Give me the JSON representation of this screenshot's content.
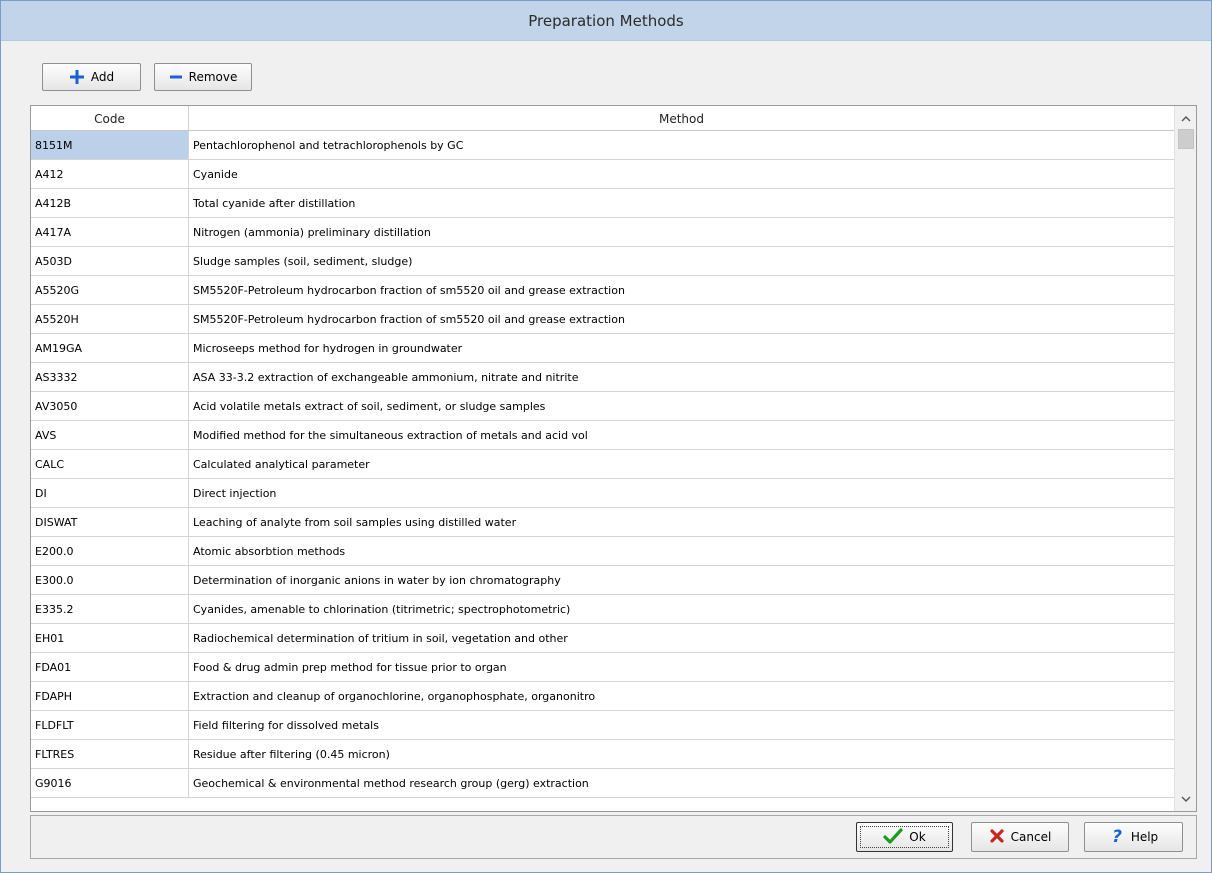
{
  "window": {
    "title": "Preparation Methods"
  },
  "toolbar": {
    "add_label": "Add",
    "remove_label": "Remove"
  },
  "table": {
    "columns": [
      "Code",
      "Method"
    ],
    "rows": [
      {
        "code": "8151M",
        "method": "Pentachlorophenol and tetrachlorophenols by GC"
      },
      {
        "code": "A412",
        "method": "Cyanide"
      },
      {
        "code": "A412B",
        "method": "Total cyanide after distillation"
      },
      {
        "code": "A417A",
        "method": "Nitrogen (ammonia) preliminary distillation"
      },
      {
        "code": "A503D",
        "method": "Sludge samples (soil, sediment, sludge)"
      },
      {
        "code": "A5520G",
        "method": "SM5520F-Petroleum hydrocarbon fraction of sm5520 oil and grease extraction"
      },
      {
        "code": "A5520H",
        "method": "SM5520F-Petroleum hydrocarbon fraction of sm5520 oil and grease extraction"
      },
      {
        "code": "AM19GA",
        "method": "Microseeps method for hydrogen in groundwater"
      },
      {
        "code": "AS3332",
        "method": "ASA 33-3.2 extraction of exchangeable ammonium, nitrate and nitrite"
      },
      {
        "code": "AV3050",
        "method": "Acid volatile metals extract of soil, sediment, or sludge samples"
      },
      {
        "code": "AVS",
        "method": "Modified method for the simultaneous extraction of metals and acid vol"
      },
      {
        "code": "CALC",
        "method": "Calculated analytical parameter"
      },
      {
        "code": "DI",
        "method": "Direct injection"
      },
      {
        "code": "DISWAT",
        "method": "Leaching of analyte from soil samples using distilled water"
      },
      {
        "code": "E200.0",
        "method": "Atomic absorbtion methods"
      },
      {
        "code": "E300.0",
        "method": "Determination of inorganic anions in water by ion chromatography"
      },
      {
        "code": "E335.2",
        "method": "Cyanides, amenable to chlorination (titrimetric; spectrophotometric)"
      },
      {
        "code": "EH01",
        "method": "Radiochemical determination of tritium in soil, vegetation and other"
      },
      {
        "code": "FDA01",
        "method": "Food & drug admin prep method for tissue prior to organ"
      },
      {
        "code": "FDAPH",
        "method": "Extraction and cleanup of organochlorine, organophosphate, organonitro"
      },
      {
        "code": "FLDFLT",
        "method": "Field filtering for dissolved metals"
      },
      {
        "code": "FLTRES",
        "method": "Residue after filtering (0.45 micron)"
      },
      {
        "code": "G9016",
        "method": "Geochemical & environmental method research group (gerg) extraction"
      }
    ],
    "selected_code": "8151M"
  },
  "footer": {
    "ok_label": "Ok",
    "cancel_label": "Cancel",
    "help_label": "Help"
  },
  "icons": {
    "add": "plus-icon",
    "remove": "minus-icon",
    "ok": "checkmark-icon",
    "cancel": "x-icon",
    "help": "question-mark-icon",
    "scroll_up": "chevron-up-icon",
    "scroll_down": "chevron-down-icon"
  },
  "colors": {
    "title_bar": "#c2d4ea",
    "selection": "#bcd0ea",
    "add_icon": "#1a5fd6",
    "ok_icon": "#1e9a1e",
    "cancel_icon": "#c8261e",
    "help_icon": "#1a5fd6"
  }
}
